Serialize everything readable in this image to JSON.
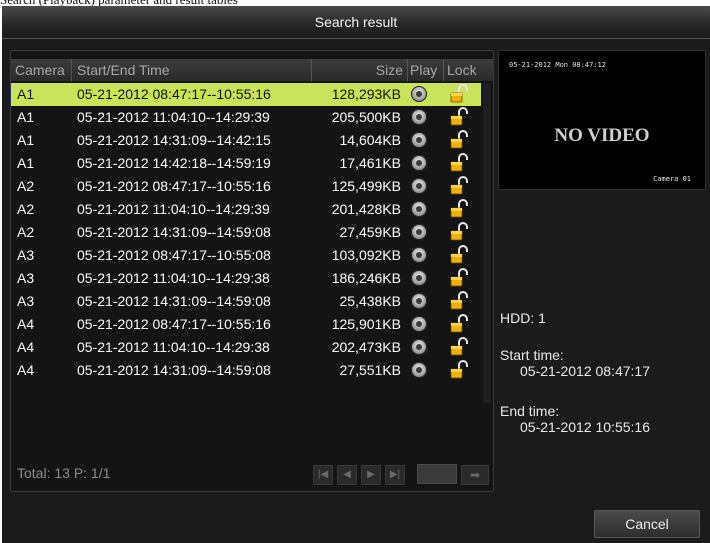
{
  "caption": "Search (Playback) parameter and result tables",
  "window": {
    "title": "Search result"
  },
  "columns": {
    "camera": "Camera",
    "time": "Start/End Time",
    "size": "Size",
    "play": "Play",
    "lock": "Lock"
  },
  "rows": [
    {
      "camera": "A1",
      "time": "05-21-2012 08:47:17--10:55:16",
      "size": "128,293KB",
      "selected": true
    },
    {
      "camera": "A1",
      "time": "05-21-2012 11:04:10--14:29:39",
      "size": "205,500KB",
      "selected": false
    },
    {
      "camera": "A1",
      "time": "05-21-2012 14:31:09--14:42:15",
      "size": "14,604KB",
      "selected": false
    },
    {
      "camera": "A1",
      "time": "05-21-2012 14:42:18--14:59:19",
      "size": "17,461KB",
      "selected": false
    },
    {
      "camera": "A2",
      "time": "05-21-2012 08:47:17--10:55:16",
      "size": "125,499KB",
      "selected": false
    },
    {
      "camera": "A2",
      "time": "05-21-2012 11:04:10--14:29:39",
      "size": "201,428KB",
      "selected": false
    },
    {
      "camera": "A2",
      "time": "05-21-2012 14:31:09--14:59:08",
      "size": "27,459KB",
      "selected": false
    },
    {
      "camera": "A3",
      "time": "05-21-2012 08:47:17--10:55:08",
      "size": "103,092KB",
      "selected": false
    },
    {
      "camera": "A3",
      "time": "05-21-2012 11:04:10--14:29:38",
      "size": "186,246KB",
      "selected": false
    },
    {
      "camera": "A3",
      "time": "05-21-2012 14:31:09--14:59:08",
      "size": "25,438KB",
      "selected": false
    },
    {
      "camera": "A4",
      "time": "05-21-2012 08:47:17--10:55:16",
      "size": "125,901KB",
      "selected": false
    },
    {
      "camera": "A4",
      "time": "05-21-2012 11:04:10--14:29:38",
      "size": "202,473KB",
      "selected": false
    },
    {
      "camera": "A4",
      "time": "05-21-2012 14:31:09--14:59:08",
      "size": "27,551KB",
      "selected": false
    }
  ],
  "footer": {
    "total": "Total: 13  P: 1/1",
    "page_value": ""
  },
  "preview": {
    "timestamp": "05-21-2012 Mon 08:47:12",
    "no_video": "NO VIDEO",
    "camera_label": "Camera 01"
  },
  "info": {
    "hdd": "HDD: 1",
    "start_label": "Start time:",
    "start_value": "05-21-2012 08:47:17",
    "end_label": "End time:",
    "end_value": "05-21-2012 10:55:16"
  },
  "buttons": {
    "cancel": "Cancel"
  },
  "colors": {
    "selected_row": "#cbe35a",
    "window_bg": "#1b1b1b"
  }
}
